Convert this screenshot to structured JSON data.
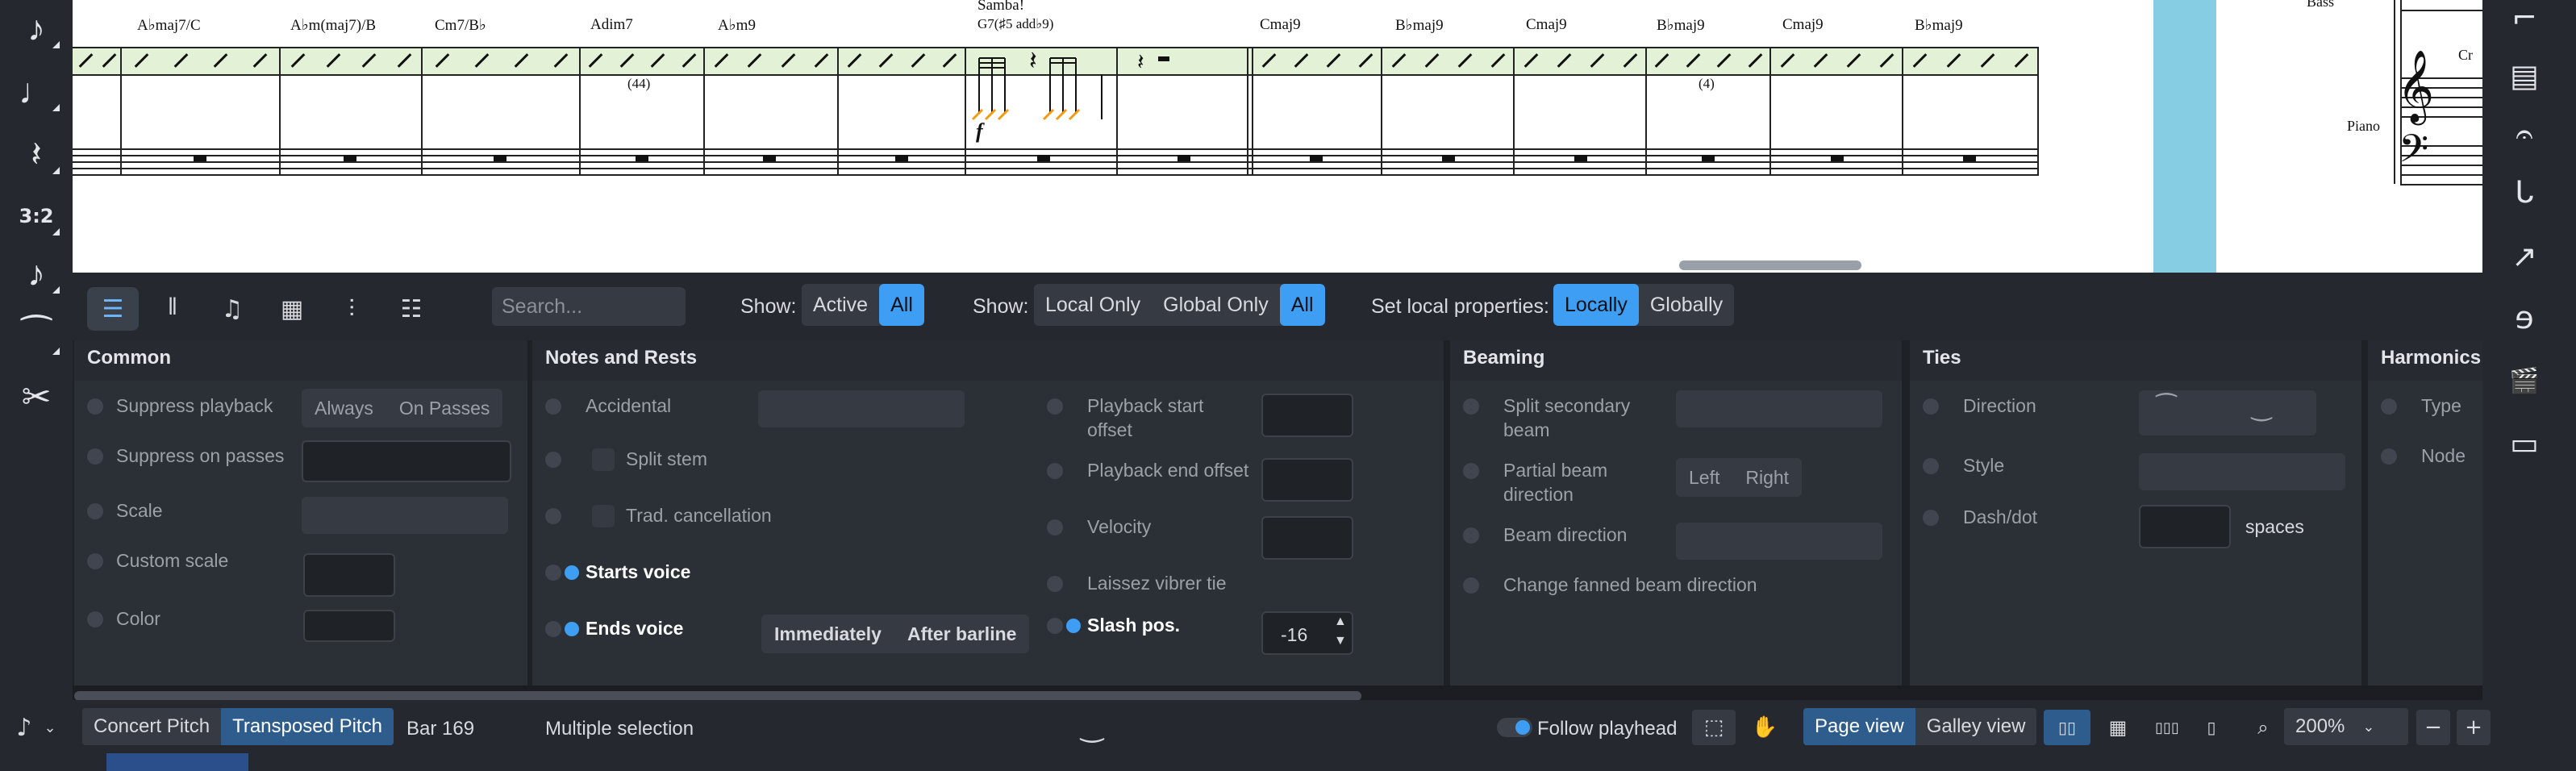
{
  "colors": {
    "accent": "#3e9ef4",
    "panel_bg": "#2b2f36",
    "toolbar_bg": "#25282e",
    "score_bg": "#ffffff",
    "slash_staff_highlight": "#e3f1d7",
    "sidebar_blue": "#86cde3"
  },
  "left_toolbar": {
    "items": [
      {
        "icon": "eighth-note-icon",
        "glyph": "♪"
      },
      {
        "icon": "dotted-quarter-note-icon",
        "glyph": "♩"
      },
      {
        "icon": "quarter-rest-icon",
        "glyph": "𝄽"
      },
      {
        "icon": "tuplet-icon",
        "glyph": "3:2"
      },
      {
        "icon": "grace-note-icon",
        "glyph": "♪"
      },
      {
        "icon": "tie-icon",
        "glyph": "⁀"
      },
      {
        "icon": "scissors-icon",
        "glyph": "✂"
      }
    ]
  },
  "score": {
    "chords": [
      "A♭maj7/C",
      "A♭m(maj7)/B",
      "Cm7/B♭",
      "Adim7",
      "A♭m9",
      "Samba!",
      "G7(♯5 add♭9)",
      "Cmaj9",
      "B♭maj9",
      "Cmaj9",
      "B♭maj9",
      "Cmaj9",
      "B♭maj9"
    ],
    "bar_counts": [
      "(44)",
      "(4)"
    ],
    "dynamic": "f",
    "instruments": [
      "Bass",
      "Cr",
      "Piano"
    ]
  },
  "right_toolbar": {
    "items": [
      {
        "icon": "line-start-icon",
        "glyph": "⌐"
      },
      {
        "icon": "page-layout-icon",
        "glyph": "▤"
      },
      {
        "icon": "fermata-icon",
        "glyph": "𝄐"
      },
      {
        "icon": "breath-mark-icon",
        "glyph": "ᒐ"
      },
      {
        "icon": "arrow-line-icon",
        "glyph": "↗"
      },
      {
        "icon": "ear-icon",
        "glyph": "ɘ"
      },
      {
        "icon": "video-icon",
        "glyph": "🎬"
      },
      {
        "icon": "comment-icon",
        "glyph": "▭"
      }
    ]
  },
  "properties_toolbar": {
    "search_placeholder": "Search...",
    "show_label": "Show:",
    "show_filter": {
      "options": [
        "Active",
        "All"
      ],
      "selected": "All"
    },
    "show_scope": {
      "options": [
        "Local Only",
        "Global Only",
        "All"
      ],
      "selected": "All"
    },
    "set_local_label": "Set local properties:",
    "set_local": {
      "options": [
        "Locally",
        "Globally"
      ],
      "selected": "Locally"
    }
  },
  "sections": {
    "common": {
      "title": "Common",
      "suppress_playback": "Suppress playback",
      "always": "Always",
      "on_passes": "On Passes",
      "suppress_on_passes": "Suppress on passes",
      "scale": "Scale",
      "custom_scale": "Custom scale",
      "color": "Color"
    },
    "notes_rests": {
      "title": "Notes and Rests",
      "accidental": "Accidental",
      "split_stem": "Split stem",
      "trad_cancellation": "Trad. cancellation",
      "starts_voice": "Starts voice",
      "ends_voice": "Ends voice",
      "immediately": "Immediately",
      "after_barline": "After barline",
      "playback_start_offset_1": "Playback start",
      "playback_start_offset_2": "offset",
      "playback_end_offset": "Playback end offset",
      "velocity": "Velocity",
      "laissez_vibrer_tie": "Laissez vibrer tie",
      "slash_pos": "Slash pos.",
      "slash_pos_value": "-16"
    },
    "beaming": {
      "title": "Beaming",
      "split_secondary_beam_1": "Split secondary",
      "split_secondary_beam_2": "beam",
      "partial_beam_direction_1": "Partial beam",
      "partial_beam_direction_2": "direction",
      "left": "Left",
      "right": "Right",
      "beam_direction": "Beam direction",
      "change_fanned": "Change fanned beam direction"
    },
    "ties": {
      "title": "Ties",
      "direction": "Direction",
      "style": "Style",
      "dash_dot": "Dash/dot",
      "spaces": "spaces"
    },
    "harmonics": {
      "title": "Harmonics",
      "type": "Type",
      "node": "Node"
    }
  },
  "status_bar": {
    "pitch": {
      "options": [
        "Concert Pitch",
        "Transposed Pitch"
      ],
      "selected": "Transposed Pitch"
    },
    "bar": "Bar 169",
    "selection": "Multiple selection",
    "follow_playhead": "Follow playhead",
    "view": {
      "options": [
        "Page view",
        "Galley view"
      ],
      "selected": "Page view"
    },
    "zoom": "200%"
  }
}
